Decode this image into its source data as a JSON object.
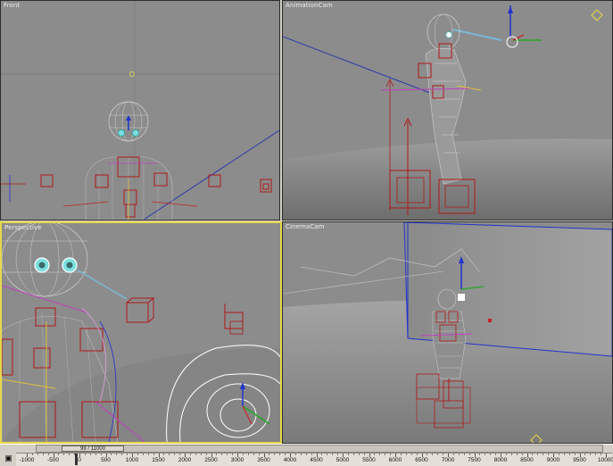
{
  "viewports": {
    "front": {
      "label": "Front"
    },
    "animation_cam": {
      "label": "AnimationCam"
    },
    "perspective": {
      "label": "Perspective"
    },
    "cinema_cam": {
      "label": "CinemaCam"
    }
  },
  "timeline": {
    "slider_text": "99 / 11000",
    "track_icon": "track-bar-icon",
    "ruler_labels": [
      "-1000",
      "-500",
      "0",
      "500",
      "1000",
      "1500",
      "2000",
      "2500",
      "3000",
      "3500",
      "4000",
      "4500",
      "5000",
      "5500",
      "6000",
      "6500",
      "7000",
      "7500",
      "8000",
      "8500",
      "9000",
      "9500",
      "10000"
    ]
  },
  "colors": {
    "viewport_bg": "#8c8c8c",
    "active_border": "#e6d84a",
    "rig_red": "#b01818",
    "mesh_grey": "#c8c8c8",
    "axis_blue": "#2233cc"
  }
}
